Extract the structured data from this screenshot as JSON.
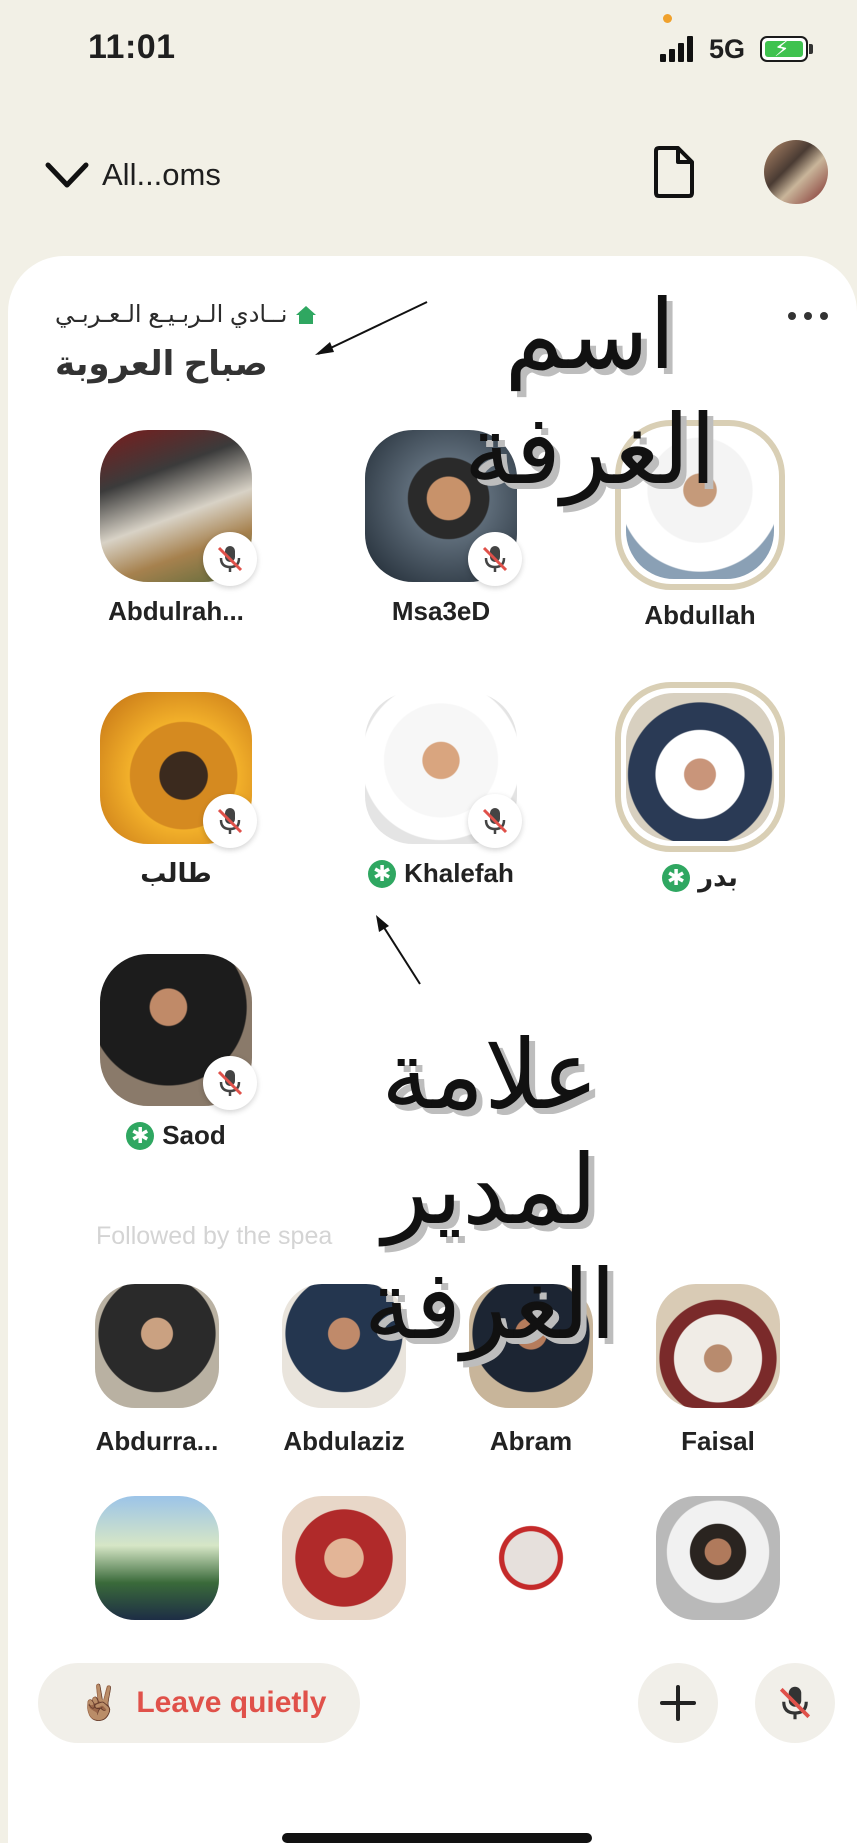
{
  "status_bar": {
    "time": "11:01",
    "network": "5G"
  },
  "nav": {
    "back_label": "All...oms"
  },
  "room": {
    "club_name": "نــادي الـربـيـع الـعـربـي",
    "title": "صباح العروبة"
  },
  "speakers": [
    {
      "name": "Abdulrah...",
      "muted": true,
      "moderator": false
    },
    {
      "name": "Msa3eD",
      "muted": true,
      "moderator": false
    },
    {
      "name": "Abdullah",
      "muted": false,
      "moderator": false
    },
    {
      "name": "طالب",
      "muted": true,
      "moderator": false
    },
    {
      "name": "Khalefah",
      "muted": true,
      "moderator": true
    },
    {
      "name": "بدر",
      "muted": false,
      "moderator": true
    },
    {
      "name": "Saod",
      "muted": true,
      "moderator": true
    }
  ],
  "followed_label": "Followed by the spea",
  "followers": [
    {
      "name": "Abdurra..."
    },
    {
      "name": "Abdulaziz"
    },
    {
      "name": "Abram"
    },
    {
      "name": "Faisal"
    },
    {
      "name": ""
    },
    {
      "name": ""
    },
    {
      "name": ""
    },
    {
      "name": ""
    }
  ],
  "annotations": {
    "room_name": "اسم الغرفة",
    "moderator_mark": "علامة لمدير الغرفة"
  },
  "bottom_bar": {
    "leave_label": "Leave quietly",
    "leave_emoji": "✌🏽"
  },
  "colors": {
    "accent_red": "#e0514a",
    "moderator_green": "#2fa761",
    "sheet_bg": "#ffffff",
    "top_bg": "#f2f0e6"
  }
}
